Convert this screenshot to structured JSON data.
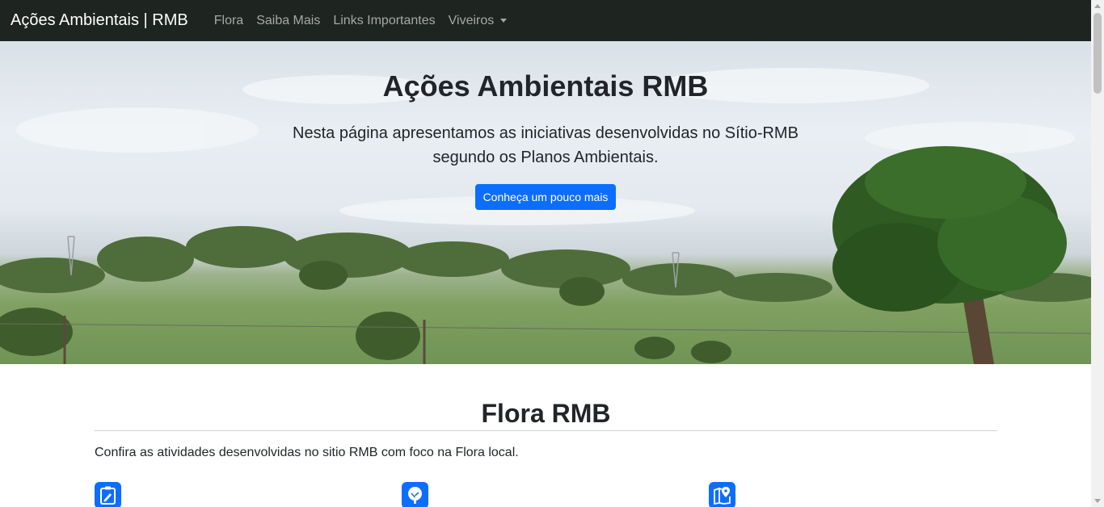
{
  "navbar": {
    "brand": "Ações Ambientais | RMB",
    "links": [
      "Flora",
      "Saiba Mais",
      "Links Importantes"
    ],
    "dropdown": "Viveiros"
  },
  "hero": {
    "title": "Ações Ambientais RMB",
    "lead": "Nesta página apresentamos as iniciativas desenvolvidas no Sítio-RMB segundo os Planos Ambientais.",
    "button": "Conheça um pouco mais"
  },
  "flora": {
    "title": "Flora RMB",
    "text": "Confira as atividades desenvolvidas no sitio RMB com foco na Flora local.",
    "icons": [
      "clipboard-pencil-icon",
      "tree-icon",
      "map-pin-icon"
    ]
  },
  "colors": {
    "navbar": "#1e2420",
    "primary": "#0d6efd"
  }
}
